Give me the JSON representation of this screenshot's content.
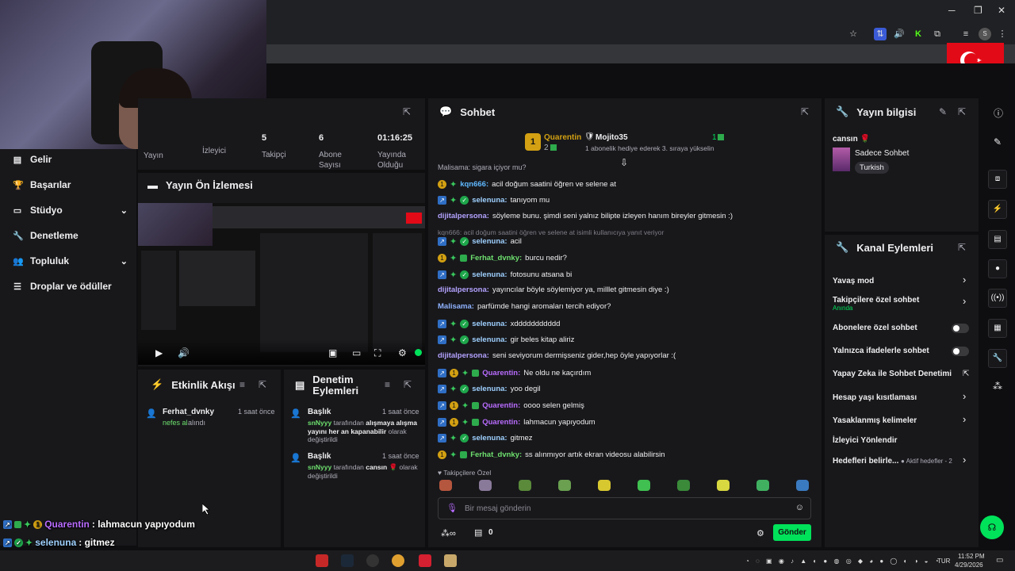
{
  "browser": {
    "window_controls": [
      "─",
      "❐",
      "✕"
    ],
    "extensions": [
      "☆",
      "⇅",
      "🔊",
      "K",
      "⧉",
      "≡",
      "S",
      "⋮"
    ]
  },
  "sidebar": {
    "items": [
      {
        "label": "Gelir",
        "icon": "wallet-icon",
        "chevron": false
      },
      {
        "label": "Başarılar",
        "icon": "trophy-icon",
        "chevron": false
      },
      {
        "label": "Stüdyo",
        "icon": "studio-icon",
        "chevron": true
      },
      {
        "label": "Denetleme",
        "icon": "wrench-icon",
        "chevron": false
      },
      {
        "label": "Topluluk",
        "icon": "people-icon",
        "chevron": true
      },
      {
        "label": "Droplar ve ödüller",
        "icon": "drops-icon",
        "chevron": false
      }
    ]
  },
  "stats": [
    {
      "value": "",
      "label": "Yayın"
    },
    {
      "value": "",
      "label": "İzleyici"
    },
    {
      "value": "5",
      "label": "Takipçi"
    },
    {
      "value": "6",
      "label": "Abone Sayısı"
    },
    {
      "value": "01:16:25",
      "label": "Yayında Olduğu"
    }
  ],
  "preview": {
    "title": "Yayın Ön İzlemesi"
  },
  "activity": {
    "title": "Etkinlik Akışı",
    "items": [
      {
        "user": "Ferhat_dvnky",
        "time": "1 saat önce",
        "action": "nefes al",
        "suffix": "alındı"
      }
    ]
  },
  "modlog": {
    "title": "Denetim Eylemleri",
    "items": [
      {
        "title": "Başlık",
        "time": "1 saat önce",
        "actor": "snNyyy",
        "mid": "tarafından",
        "value": "alışmaya alışma yayını her an kapanabilir",
        "suffix": "olarak değiştirildi"
      },
      {
        "title": "Başlık",
        "time": "1 saat önce",
        "actor": "snNyyy",
        "mid": "tarafından",
        "value": "cansın 🌹",
        "suffix": "olarak değiştirildi"
      }
    ]
  },
  "chat": {
    "title": "Sohbet",
    "leader1": {
      "rank": "1",
      "name": "Quarentin",
      "count": "2"
    },
    "leader2": {
      "name": "Mojito35",
      "count": "1",
      "desc": "1 abonelik hediye ederek 3. sıraya yükselin"
    },
    "cut_line": "Malisama: sigara içiyor mu?",
    "reply_note": "kqn666: acil doğum saatini öğren ve selene at isimli kullanıcıya yanıt veriyor",
    "messages": [
      {
        "badges": [
          "gold",
          "star"
        ],
        "user": "kqn666",
        "color": "#5fb8ff",
        "text": "acil doğum saatini öğren ve selene at"
      },
      {
        "badges": [
          "vip",
          "star",
          "mod"
        ],
        "user": "selenuna",
        "color": "#9fd1ff",
        "text": "tanıyom mu"
      },
      {
        "badges": [],
        "user": "dijitalpersona",
        "color": "#b4a2ff",
        "text": "söyleme bunu. şimdi seni yalnız bilipte izleyen hanım bireyler gitmesin :)"
      },
      {
        "badges": [
          "vip",
          "star",
          "mod"
        ],
        "user": "selenuna",
        "color": "#9fd1ff",
        "text": "acil"
      },
      {
        "badges": [
          "gold",
          "star",
          "sub"
        ],
        "user": "Ferhat_dvnky",
        "color": "#6ee06e",
        "text": "burcu nedir?"
      },
      {
        "badges": [
          "vip",
          "star",
          "mod"
        ],
        "user": "selenuna",
        "color": "#9fd1ff",
        "text": "fotosunu atsana bi"
      },
      {
        "badges": [],
        "user": "dijitalpersona",
        "color": "#b4a2ff",
        "text": "yayıncılar böyle söylemiyor ya, milllet gitmesin diye :)"
      },
      {
        "badges": [],
        "user": "Malisama",
        "color": "#8fb3ff",
        "text": "parfümde hangi aromaları tercih ediyor?"
      },
      {
        "badges": [
          "vip",
          "star",
          "mod"
        ],
        "user": "selenuna",
        "color": "#9fd1ff",
        "text": "xddddddddddd"
      },
      {
        "badges": [
          "vip",
          "star",
          "mod"
        ],
        "user": "selenuna",
        "color": "#9fd1ff",
        "text": "gir beles kitap aliriz"
      },
      {
        "badges": [],
        "user": "dijitalpersona",
        "color": "#b4a2ff",
        "text": "seni seviyorum dermişseniz gider,hep öyle yapıyorlar :("
      },
      {
        "badges": [
          "vip",
          "gold",
          "star",
          "sub"
        ],
        "user": "Quarentin",
        "color": "#b96cff",
        "text": "Ne oldu ne kaçırdım"
      },
      {
        "badges": [
          "vip",
          "star",
          "mod"
        ],
        "user": "selenuna",
        "color": "#9fd1ff",
        "text": "yoo degil"
      },
      {
        "badges": [
          "vip",
          "gold",
          "star",
          "sub"
        ],
        "user": "Quarentin",
        "color": "#b96cff",
        "text": "oooo selen gelmiş"
      },
      {
        "badges": [
          "vip",
          "gold",
          "star",
          "sub"
        ],
        "user": "Quarentin",
        "color": "#b96cff",
        "text": "lahmacun yapıyodum"
      },
      {
        "badges": [
          "vip",
          "star",
          "mod"
        ],
        "user": "selenuna",
        "color": "#9fd1ff",
        "text": "gitmez"
      },
      {
        "badges": [
          "gold",
          "star",
          "sub"
        ],
        "user": "Ferhat_dvnky",
        "color": "#6ee06e",
        "text": "ss alınmıyor artık ekran videosu alabilirsin"
      }
    ],
    "emote_label": "♥ Takipçilere Özel",
    "input_placeholder": "Bir mesaj gönderin",
    "points": "0",
    "send_label": "Gönder"
  },
  "streaminfo": {
    "title": "Yayın bilgisi",
    "stream_title": "cansın 🌹",
    "category": "Sadece Sohbet",
    "tag": "Turkish"
  },
  "actions": {
    "title": "Kanal Eylemleri",
    "items": [
      {
        "label": "Yavaş mod",
        "type": "chevron"
      },
      {
        "label": "Takipçilere özel sohbet",
        "sub": "Anında",
        "type": "chevron"
      },
      {
        "label": "Abonelere özel sohbet",
        "type": "toggle"
      },
      {
        "label": "Yalnızca ifadelerle sohbet",
        "type": "toggle"
      },
      {
        "label": "Yapay Zeka ile Sohbet Denetimi",
        "type": "external"
      },
      {
        "label": "Hesap yaşı kısıtlaması",
        "type": "chevron"
      },
      {
        "label": "Yasaklanmış kelimeler",
        "type": "chevron"
      },
      {
        "label": "İzleyici Yönlendir",
        "type": "none"
      },
      {
        "label": "Hedefleri belirle...",
        "sub": "Aktif hedefler - 2",
        "type": "chevron"
      }
    ]
  },
  "overlay": [
    {
      "user": "Quarentin",
      "color": "#b96cff",
      "text": ": lahmacun yapıyodum"
    },
    {
      "user": "selenuna",
      "color": "#9fd1ff",
      "text": ": gitmez"
    },
    {
      "user": "Ferhat_dvnky",
      "color": "#6ee06e",
      "text": ": ss alınmıyor artık ekran videosu alabilirsin"
    }
  ],
  "taskbar": {
    "lang": "TUR",
    "time": "11:52 PM",
    "date": "4/29/2026"
  },
  "colors": {
    "accent_green": "#00e25a",
    "panel": "#18181b",
    "bg": "#0e0e10",
    "flag": "#e30a17"
  }
}
